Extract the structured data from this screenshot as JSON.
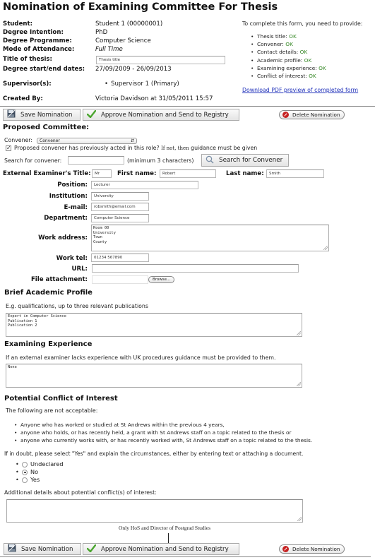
{
  "page": {
    "title": "Nomination of Examining Committee For Thesis"
  },
  "student_info": {
    "student_label": "Student:",
    "student_value": "Student 1 (00000001)",
    "degree_intention_label": "Degree Intention:",
    "degree_intention_value": "PhD",
    "degree_programme_label": "Degree Programme:",
    "degree_programme_value": "Computer Science",
    "mode_label": "Mode of Attendance:",
    "mode_value": "Full Time",
    "thesis_title_label": "Title of thesis:",
    "thesis_title_value": "Thesis title",
    "dates_label": "Degree start/end dates:",
    "dates_value": "27/09/2009 - 26/09/2013",
    "supervisors_label": "Supervisor(s):",
    "supervisors": [
      "Supervisor 1 (Primary)"
    ],
    "created_by_label": "Created By:",
    "created_by_value": "Victoria Davidson at 31/05/2011 15:57"
  },
  "requirements": {
    "intro": "To complete this form, you need to provide:",
    "items": [
      {
        "label": "Thesis title:",
        "status": "OK"
      },
      {
        "label": "Convener:",
        "status": "OK"
      },
      {
        "label": "Contact details:",
        "status": "OK"
      },
      {
        "label": "Academic profile:",
        "status": "OK"
      },
      {
        "label": "Examining experience:",
        "status": "OK"
      },
      {
        "label": "Conflict of interest:",
        "status": "OK"
      }
    ],
    "pdf_link": "Download PDF preview of completed form",
    "ok_color": "#3a8a2a"
  },
  "toolbar": {
    "save_label": "Save Nomination",
    "approve_label": "Approve Nomination and Send to Registry",
    "delete_label": "Delete Nomination"
  },
  "committee": {
    "heading": "Proposed Committee:",
    "convener_label": "Convener:",
    "convener_selected": "Convener",
    "prev_acted_label": "Proposed convener has previously acted in this role?",
    "prev_acted_note": "If not, then",
    "prev_acted_note2": "guidance must be given",
    "prev_acted_checked": true,
    "search_label": "Search for convener:",
    "search_value": "",
    "search_hint": "(minimum 3 characters)",
    "search_button": "Search for Convener"
  },
  "examiner": {
    "title_label": "External Examiner's Title:",
    "title_value": "Mr",
    "first_name_label": "First name:",
    "first_name_value": "Robert",
    "last_name_label": "Last name:",
    "last_name_value": "Smith",
    "position_label": "Position:",
    "position_value": "Lecturer",
    "institution_label": "Institution:",
    "institution_value": "University",
    "email_label": "E-mail:",
    "email_value": "robsmith@email.com",
    "department_label": "Department:",
    "department_value": "Computer Science",
    "address_label": "Work address:",
    "address_value": "Room 00\nUniversity\nTown\nCounty",
    "tel_label": "Work tel:",
    "tel_value": "01234 567890",
    "url_label": "URL:",
    "url_value": "",
    "file_label": "File attachment:",
    "browse_label": "Browse..."
  },
  "academic_profile": {
    "heading": "Brief Academic Profile",
    "hint": "E.g. qualifications, up to three relevant publications",
    "value": "Expert in Computer Science\nPublication 1\nPublication 2"
  },
  "experience": {
    "heading": "Examining Experience",
    "hint": "If an external examiner lacks experience with UK procedures guidance must be provided to them.",
    "value": "None"
  },
  "conflict": {
    "heading": "Potential Conflict of Interest",
    "intro": "The following are not acceptable:",
    "rules": [
      "Anyone who has worked or studied at St Andrews within the previous 4 years,",
      "anyone who holds, or has recently held, a grant with St Andrews staff on a topic related to the thesis or",
      "anyone who currently works with, or has recently worked with, St Andrews staff on a topic related to the thesis."
    ],
    "doubt_text": "If in doubt, please select \"Yes\" and explain the circumstances, either by entering text or attaching a document.",
    "options": [
      "Undeclared",
      "No",
      "Yes"
    ],
    "selected": "No",
    "details_label": "Additional details about potential conflict(s) of interest:",
    "details_value": ""
  },
  "annotation": {
    "text": "Only HoS and Director of Postgrad Studies"
  }
}
